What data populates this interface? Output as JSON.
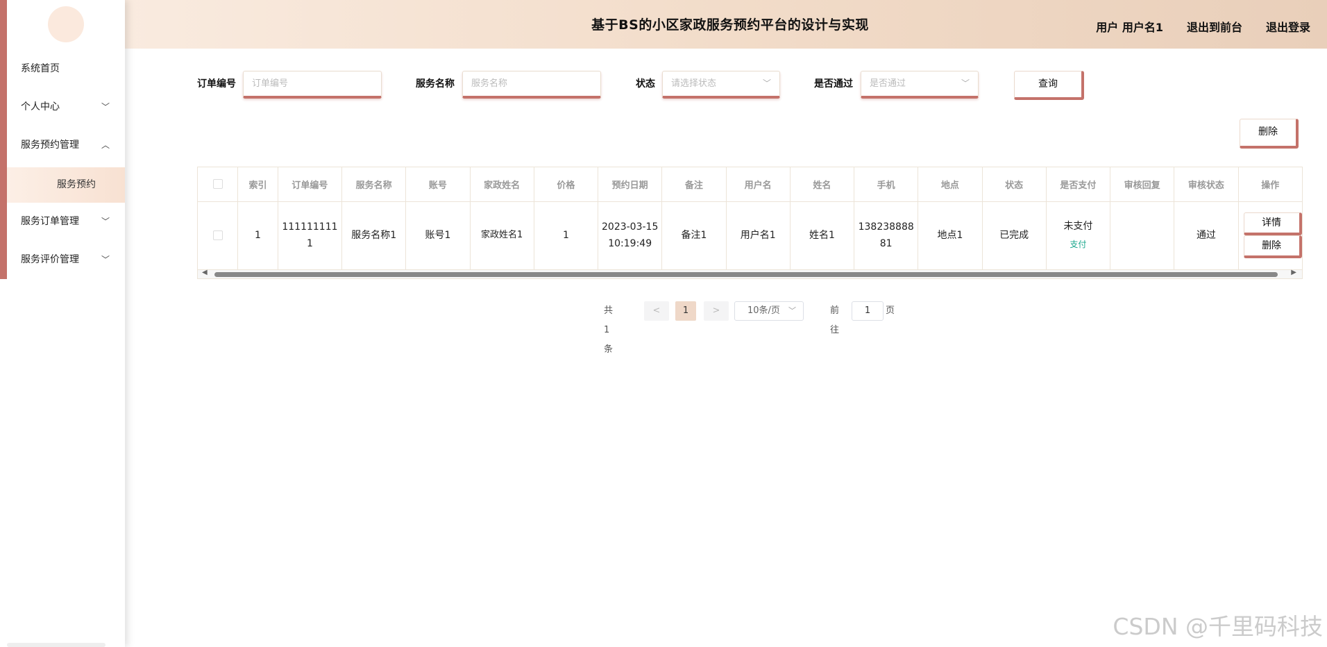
{
  "header": {
    "title": "基于BS的小区家政服务预约平台的设计与实现",
    "user": "用户 用户名1",
    "to_front": "退出到前台",
    "logout": "退出登录"
  },
  "sidebar": {
    "items": [
      {
        "label": "系统首页"
      },
      {
        "label": "个人中心"
      },
      {
        "label": "服务预约管理"
      },
      {
        "label": "服务预约"
      },
      {
        "label": "服务订单管理"
      },
      {
        "label": "服务评价管理"
      }
    ]
  },
  "search": {
    "order_no_label": "订单编号",
    "order_no_placeholder": "订单编号",
    "service_label": "服务名称",
    "service_placeholder": "服务名称",
    "status_label": "状态",
    "status_placeholder": "请选择状态",
    "approved_label": "是否通过",
    "approved_placeholder": "是否通过",
    "query_button": "查询"
  },
  "toolbar": {
    "delete_button": "删除"
  },
  "table": {
    "headers": [
      "索引",
      "订单编号",
      "服务名称",
      "账号",
      "家政姓名",
      "价格",
      "预约日期",
      "备注",
      "用户名",
      "姓名",
      "手机",
      "地点",
      "状态",
      "是否支付",
      "审核回复",
      "审核状态",
      "操作"
    ],
    "row": {
      "index": "1",
      "order_no": "1111111111",
      "service": "服务名称1",
      "account": "账号1",
      "staff": "家政姓名1",
      "price": "1",
      "date": "2023-03-15 10:19:49",
      "note": "备注1",
      "username": "用户名1",
      "name": "姓名1",
      "phone": "13823888881",
      "place": "地点1",
      "status": "已完成",
      "paid": "未支付",
      "pay_link": "支付",
      "reply": "",
      "audit": "通过",
      "detail_button": "详情",
      "delete_button": "删除"
    }
  },
  "pager": {
    "total": "共 1 条",
    "prev": "<",
    "page": "1",
    "next": ">",
    "size": "10条/页",
    "goto": "前往",
    "goto_value": "1",
    "page_unit": "页"
  },
  "watermark": "CSDN @千里码科技",
  "colors": {
    "accent": "#c4726a",
    "header_bg": "#f2dcc9",
    "pay_link": "#1aa78c"
  }
}
